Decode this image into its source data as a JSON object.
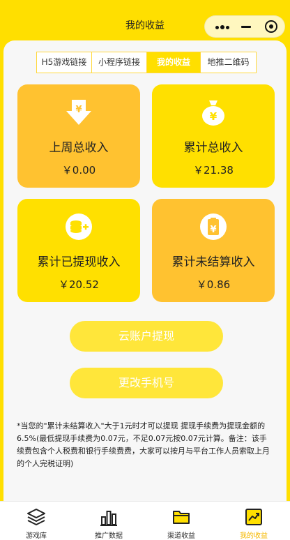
{
  "header": {
    "title": "我的收益"
  },
  "tabs": [
    {
      "label": "H5游戏链接"
    },
    {
      "label": "小程序链接"
    },
    {
      "label": "我的收益"
    },
    {
      "label": "地推二维码"
    }
  ],
  "cards": [
    {
      "label": "上周总收入",
      "amount": "￥0.00",
      "icon": "yen-down-arrow-icon"
    },
    {
      "label": "累计总收入",
      "amount": "￥21.38",
      "icon": "yen-money-bag-icon"
    },
    {
      "label": "累计已提现收入",
      "amount": "￥20.52",
      "icon": "coin-stack-plus-icon"
    },
    {
      "label": "累计未结算收入",
      "amount": "￥0.86",
      "icon": "yen-clipboard-icon"
    }
  ],
  "buttons": {
    "withdraw": "云账户提现",
    "change_phone": "更改手机号"
  },
  "note": "*当您的\"累计未结算收入\"大于1元时才可以提现 提现手续费为提现金额的6.5%(最低提现手续费为0.07元，不足0.07元按0.07元计算。备注：该手续费包含个人税费和银行手续费费，大家可以按月与平台工作人员索取上月的个人完税证明)",
  "tabbar": [
    {
      "label": "游戏库",
      "icon": "layers-icon"
    },
    {
      "label": "推广数据",
      "icon": "bar-chart-icon"
    },
    {
      "label": "渠道收益",
      "icon": "folder-icon"
    },
    {
      "label": "我的收益",
      "icon": "trend-chart-icon"
    }
  ],
  "colors": {
    "brand": "#ffdf00",
    "card_orange": "#ffc230",
    "card_yellow": "#ffe000",
    "active_tab_label": "#f5b800"
  }
}
